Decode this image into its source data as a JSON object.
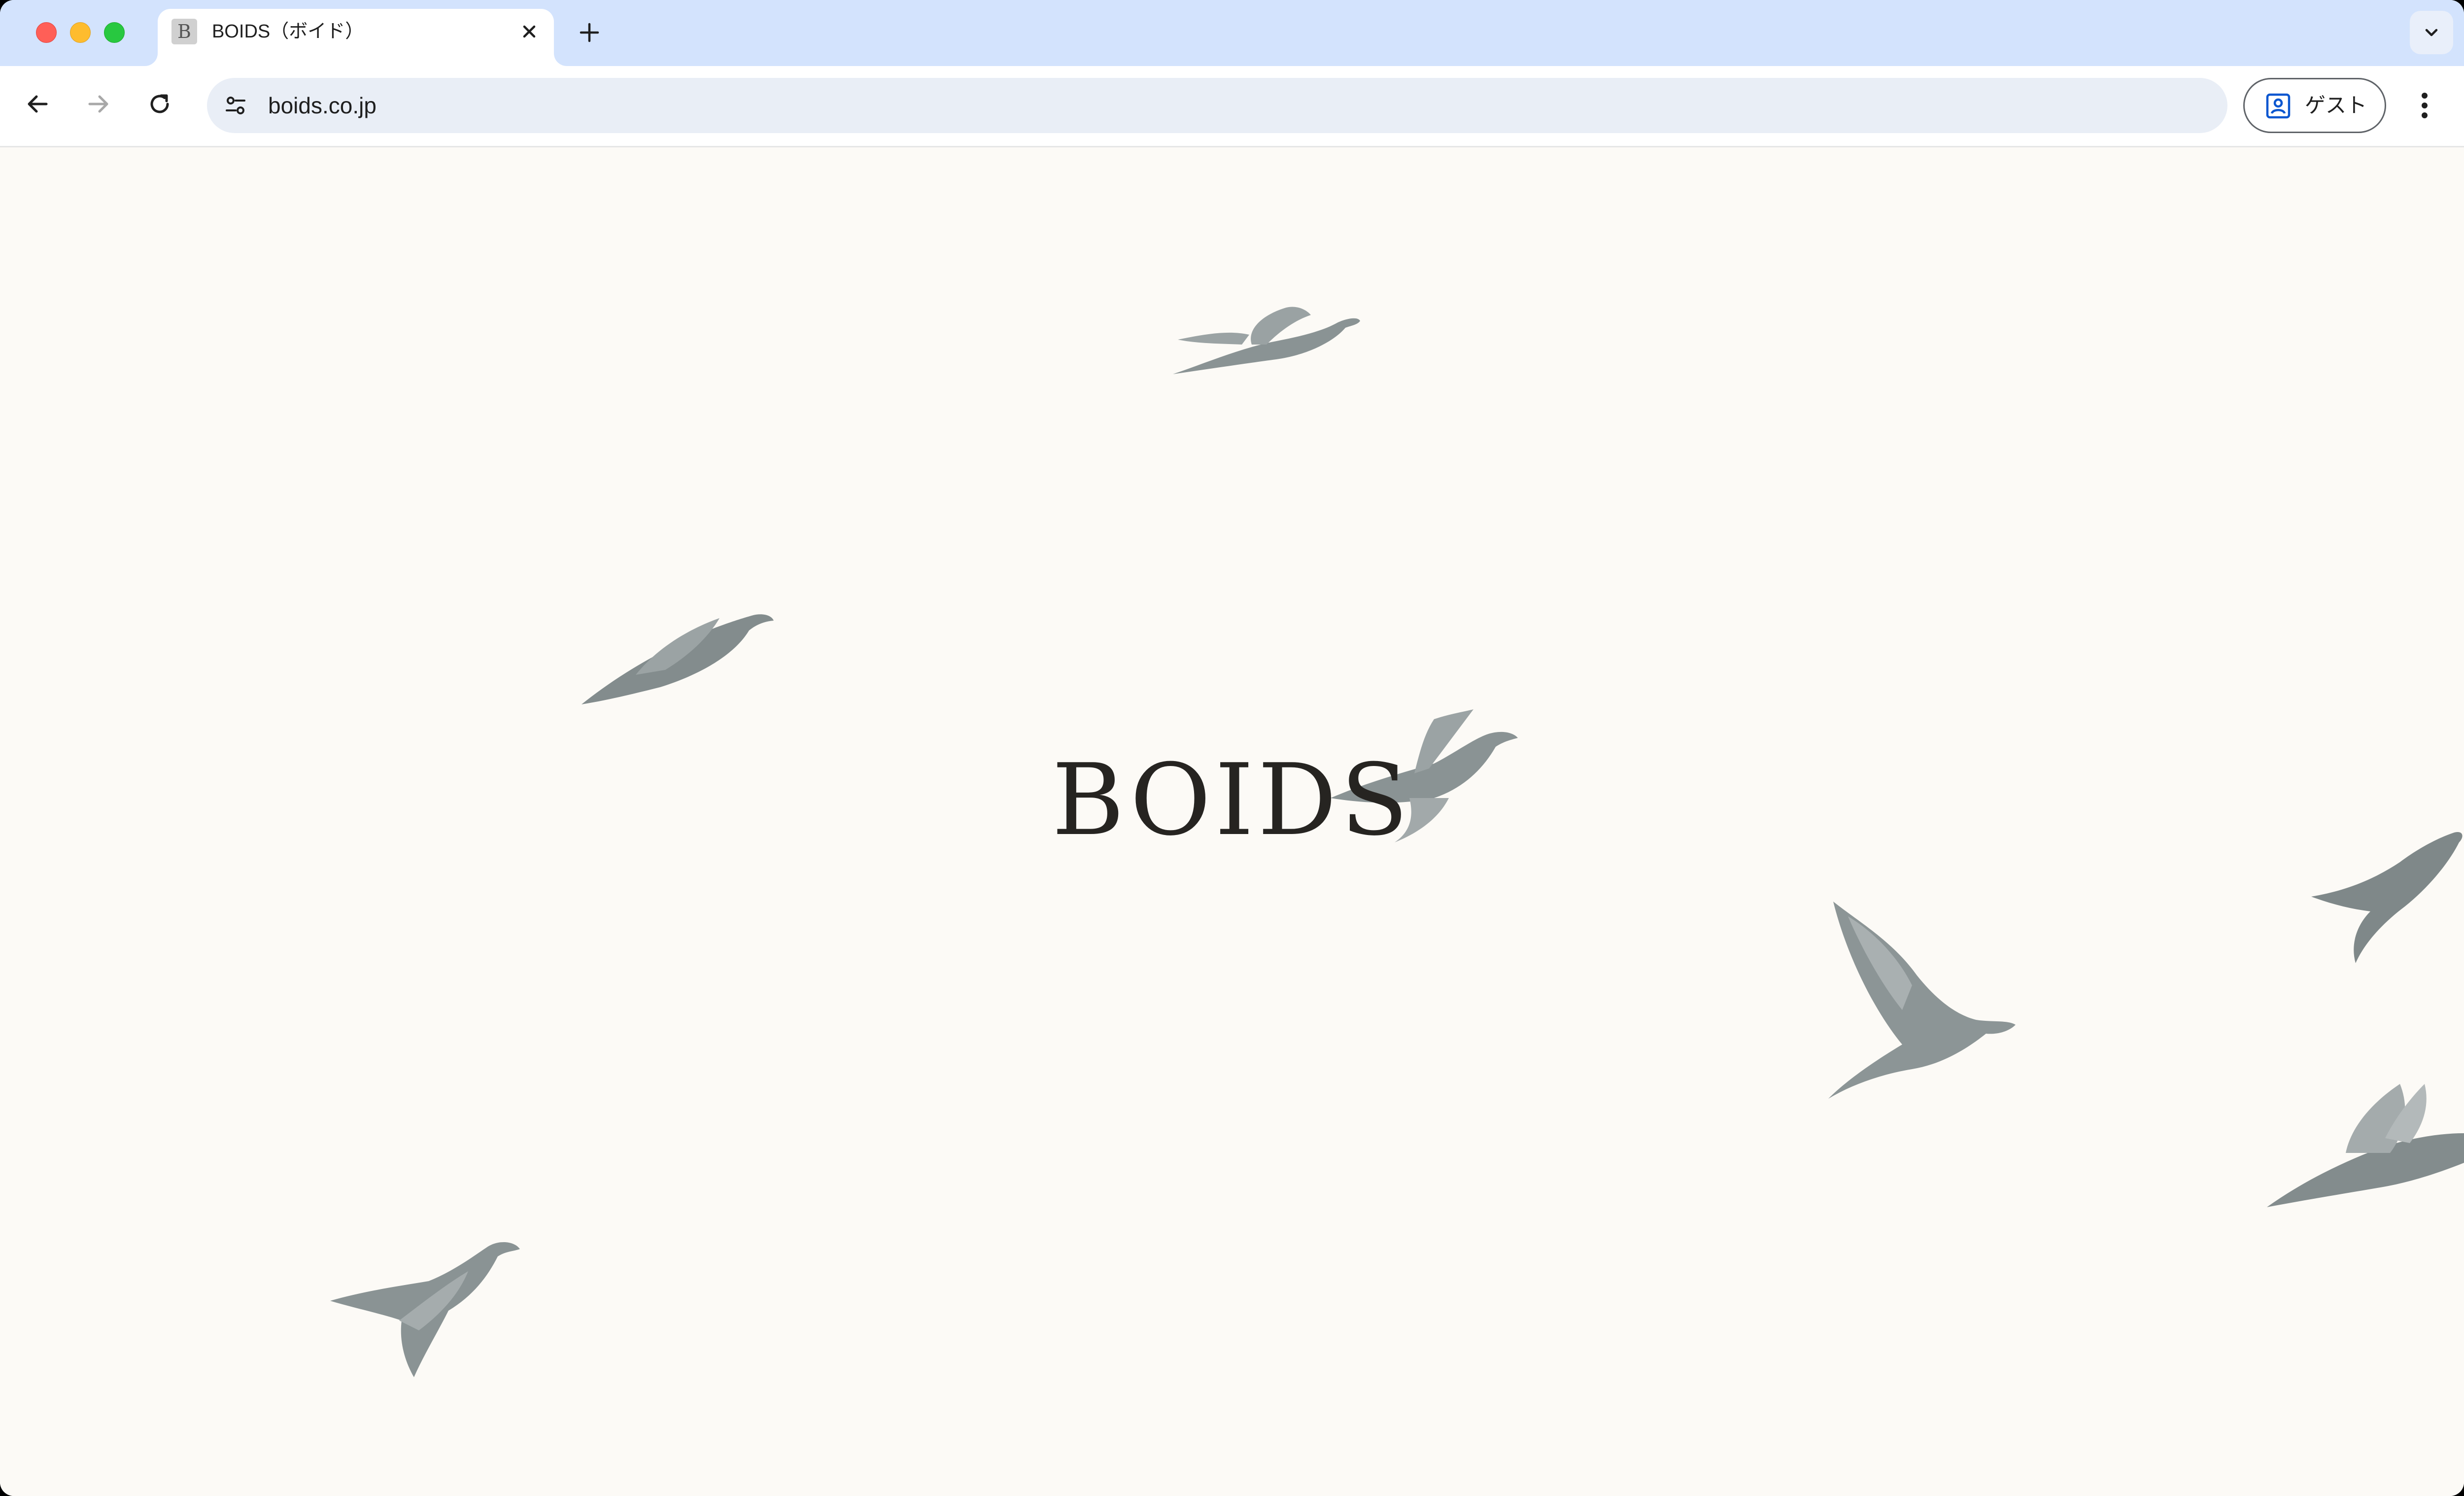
{
  "browser": {
    "tab": {
      "favicon_letter": "B",
      "title": "BOIDS（ボイド）"
    },
    "address_bar": {
      "url": "boids.co.jp"
    },
    "profile": {
      "label": "ゲスト"
    },
    "colors": {
      "tabstrip": "#d3e3fd",
      "omnibox": "#e9eef6",
      "page_background": "#fcfaf6",
      "bird": "#8a9394"
    }
  },
  "page": {
    "brand": "BOIDS"
  }
}
